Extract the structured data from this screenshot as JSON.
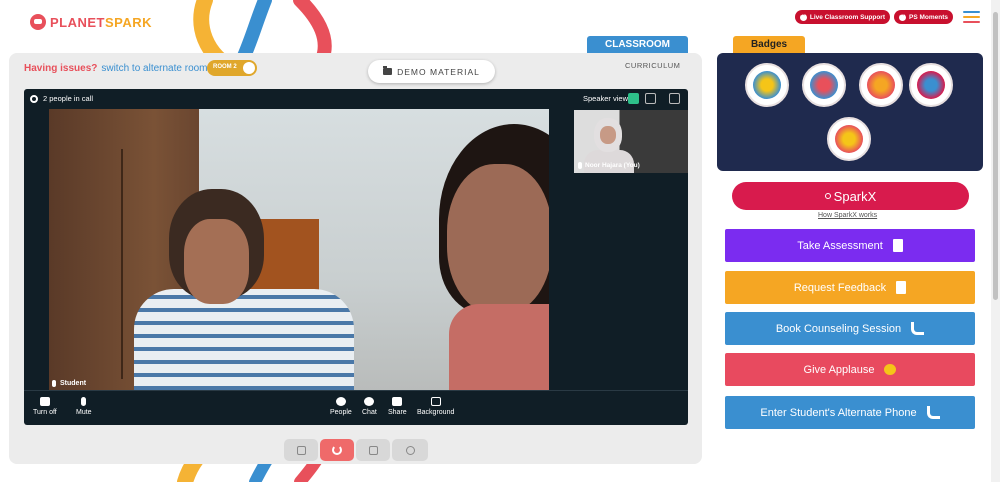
{
  "header": {
    "logo_text_planet": "PLANET",
    "logo_text_spark": "SPARK",
    "live_support_label": "Live Classroom Support",
    "ps_moments_label": "PS Moments"
  },
  "classroom": {
    "tab_label": "CLASSROOM",
    "curriculum_label": "CURRICULUM",
    "issues_question": "Having issues?",
    "switch_label": "switch to alternate room",
    "room_toggle_label": "ROOM 2",
    "demo_material_label": "DEMO MATERIAL"
  },
  "video": {
    "people_count": "2 people in call",
    "speaker_view_label": "Speaker view",
    "main_participant": "Student",
    "self_participant": "Noor Hajara (You)",
    "controls": {
      "turn_off": "Turn off",
      "mute": "Mute",
      "people": "People",
      "chat": "Chat",
      "share": "Share",
      "background": "Background"
    }
  },
  "badges": {
    "tab_label": "Badges"
  },
  "sparkx": {
    "label": "SparkX",
    "how_link": "How SparkX works"
  },
  "actions": {
    "take_assessment": "Take Assessment",
    "request_feedback": "Request Feedback",
    "book_counseling": "Book Counseling Session",
    "give_applause": "Give Applause",
    "alternate_phone": "Enter Student's Alternate Phone"
  },
  "colors": {
    "brand_red": "#e8505b",
    "classroom_blue": "#3a8fd0",
    "badges_navy": "#1f2a4e",
    "sparkx_red": "#d81b4d",
    "assessment_purple": "#7b2cf0",
    "feedback_orange": "#f5a623",
    "applause_red": "#e84a5f"
  }
}
